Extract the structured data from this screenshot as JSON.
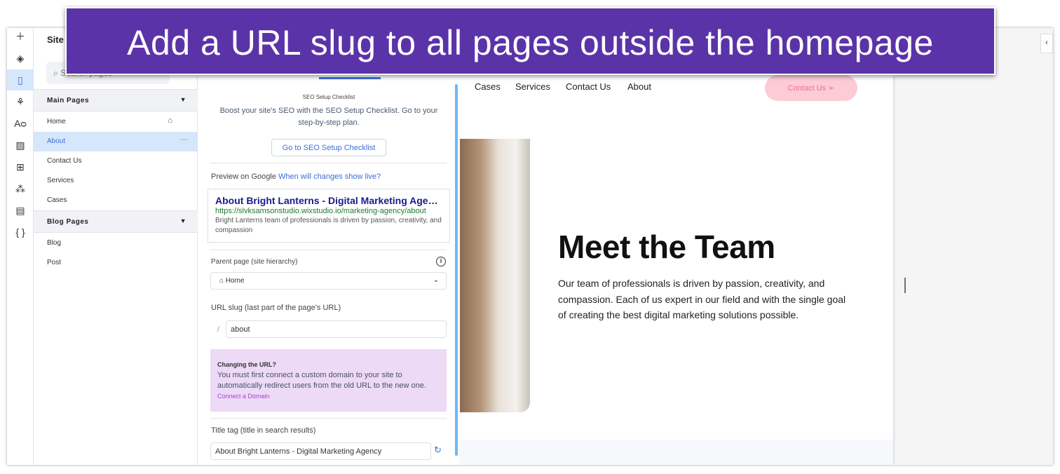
{
  "banner": {
    "text": "Add a URL slug to all pages outside the homepage"
  },
  "rail": {
    "icons": [
      "plus-icon",
      "layers-icon",
      "pages-icon",
      "design-icon",
      "typography-icon",
      "media-icon",
      "apps-icon",
      "business-icon",
      "cms-table-icon",
      "code-icon"
    ]
  },
  "pages_panel": {
    "title": "Site",
    "search_placeholder": "Search pages",
    "main_section": "Main Pages",
    "main_items": [
      "Home",
      "About",
      "Contact Us",
      "Services",
      "Cases"
    ],
    "blog_section": "Blog Pages",
    "blog_items": [
      "Blog",
      "Post"
    ],
    "selected": "About"
  },
  "seo": {
    "checklist_title": "SEO Setup Checklist",
    "checklist_desc": "Boost your site's SEO with the SEO Setup Checklist. Go to your step-by-step plan.",
    "checklist_button": "Go to SEO Setup Checklist",
    "preview_label": "Preview on Google",
    "preview_link": "When will changes show live?",
    "google_title": "About Bright Lanterns - Digital Marketing Age…",
    "google_url": "https://slvksamsonstudio.wixstudio.io/marketing-agency/about",
    "google_desc": "Bright Lanterns team of professionals is driven by passion, creativity, and compassion",
    "parent_label": "Parent page (site hierarchy)",
    "parent_value": "Home",
    "slug_label": "URL slug (last part of the page's URL)",
    "slug_prefix": "/",
    "slug_value": "about",
    "note_title": "Changing the URL?",
    "note_text": "You must first connect a custom domain to your site to automatically redirect users from the old URL to the new one.",
    "note_link": "Connect a Domain",
    "title_tag_label": "Title tag (title in search results)",
    "title_tag_value": "About Bright Lanterns - Digital Marketing Agency"
  },
  "site": {
    "nav": [
      "Cases",
      "Services",
      "Contact Us",
      "About"
    ],
    "cta": "Contact Us",
    "heading": "Meet the Team",
    "body": "Our team of professionals is driven by passion, creativity, and compassion. Each of us expert in our field and with the single goal of creating the best digital marketing solutions possible."
  },
  "colors": {
    "accent": "#3b6fd9",
    "banner": "#5b33a8",
    "note_bg": "#ecdaf7",
    "cta_bg": "#fccbd6"
  }
}
